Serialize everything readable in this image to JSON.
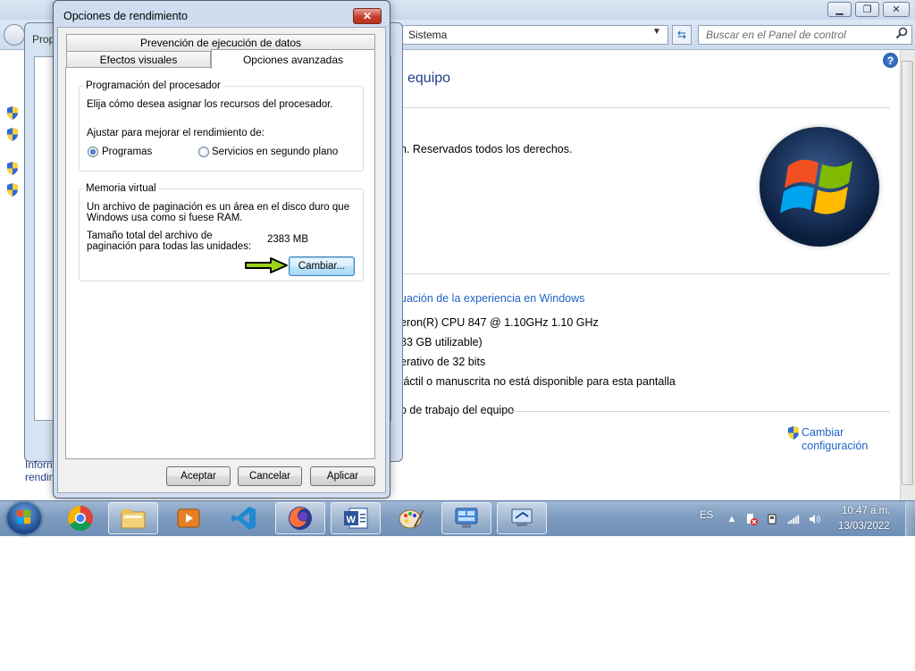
{
  "control_panel": {
    "address": "Sistema",
    "search_placeholder": "Buscar en el Panel de control",
    "heading_partial": "l equipo",
    "copyright_partial": "n. Reservados todos los derechos.",
    "rating_link_partial": "uación de la experiencia en Windows",
    "processor_partial": "eron(R) CPU 847 @ 1.10GHz   1.10 GHz",
    "ram_partial": "83 GB utilizable)",
    "system_type_partial": "erativo de 32 bits",
    "pen_touch_partial": "táctil o manuscrita no está disponible para esta pantalla",
    "workgroup_section_partial": "o de trabajo del equipo",
    "change_settings_line1": "Cambiar",
    "change_settings_line2": "configuración"
  },
  "background_dialog": {
    "title_partial": "Prop",
    "bottom_text_1": "Inforn",
    "bottom_text_2": "rendin"
  },
  "dialog": {
    "title": "Opciones de rendimiento",
    "tabs": {
      "dep": "Prevención de ejecución de datos",
      "visual": "Efectos visuales",
      "advanced": "Opciones avanzadas"
    },
    "processor_group": {
      "label": "Programación del procesador",
      "description": "Elija cómo desea asignar los recursos del procesador.",
      "adjust_label": "Ajustar para mejorar el rendimiento de:",
      "option_programs": "Programas",
      "option_services": "Servicios en segundo plano",
      "selected": "Programas"
    },
    "virtual_memory_group": {
      "label": "Memoria virtual",
      "description_line1": "Un archivo de paginación es un área en el disco duro que",
      "description_line2": "Windows usa como si fuese RAM.",
      "total_label_line1": "Tamaño total del archivo de",
      "total_label_line2": "paginación para todas las unidades:",
      "total_value": "2383 MB",
      "change_button": "Cambiar..."
    },
    "buttons": {
      "ok": "Aceptar",
      "cancel": "Cancelar",
      "apply": "Aplicar"
    }
  },
  "taskbar": {
    "language": "ES",
    "time": "10:47 a.m.",
    "date": "13/03/2022",
    "pinned": [
      "start-orb",
      "chrome-icon",
      "file-explorer-icon",
      "media-player-icon",
      "vscode-icon",
      "firefox-icon",
      "word-icon",
      "paint-icon",
      "control-panel-icon",
      "remote-desktop-icon"
    ]
  },
  "colors": {
    "link_blue": "#1f63c7",
    "heading_blue": "#1e3f86",
    "dialog_frame": "#cfddef",
    "highlight_arrow": "#9ad21a"
  }
}
